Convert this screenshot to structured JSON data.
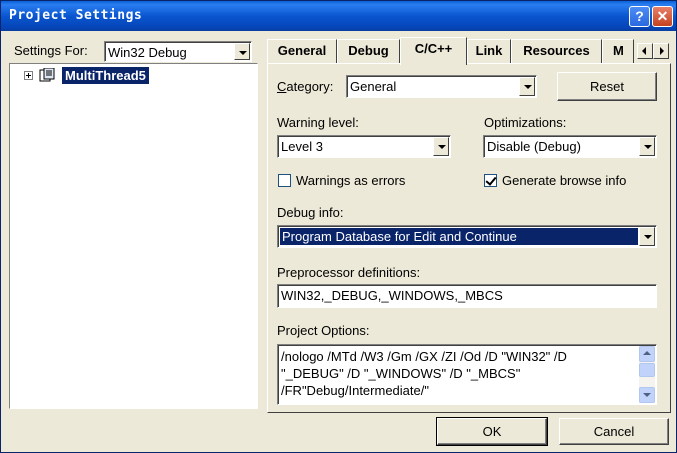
{
  "window": {
    "title": "Project Settings"
  },
  "settings_for": {
    "label": "Settings For:",
    "value": "Win32 Debug"
  },
  "tree": {
    "items": [
      {
        "label": "MultiThread5",
        "selected": true
      }
    ]
  },
  "tabs": [
    {
      "label": "General"
    },
    {
      "label": "Debug"
    },
    {
      "label": "C/C++",
      "active": true
    },
    {
      "label": "Link"
    },
    {
      "label": "Resources"
    },
    {
      "label": "M"
    }
  ],
  "category": {
    "label": "Category:",
    "value": "General"
  },
  "reset_button": "Reset",
  "warning_level": {
    "label": "Warning level:",
    "value": "Level 3"
  },
  "optimizations": {
    "label": "Optimizations:",
    "value": "Disable (Debug)"
  },
  "warnings_as_errors": {
    "label": "Warnings as errors",
    "checked": false
  },
  "generate_browse_info": {
    "label": "Generate browse info",
    "checked": true
  },
  "debug_info": {
    "label": "Debug info:",
    "value": "Program Database for Edit and Continue"
  },
  "preprocessor": {
    "label": "Preprocessor definitions:",
    "value": "WIN32,_DEBUG,_WINDOWS,_MBCS"
  },
  "project_options": {
    "label": "Project Options:",
    "lines": [
      "/nologo /MTd /W3 /Gm /GX /ZI /Od /D \"WIN32\" /D",
      "\"_DEBUG\" /D \"_WINDOWS\" /D \"_MBCS\"",
      "/FR\"Debug/Intermediate/\""
    ]
  },
  "ok_button": "OK",
  "cancel_button": "Cancel"
}
